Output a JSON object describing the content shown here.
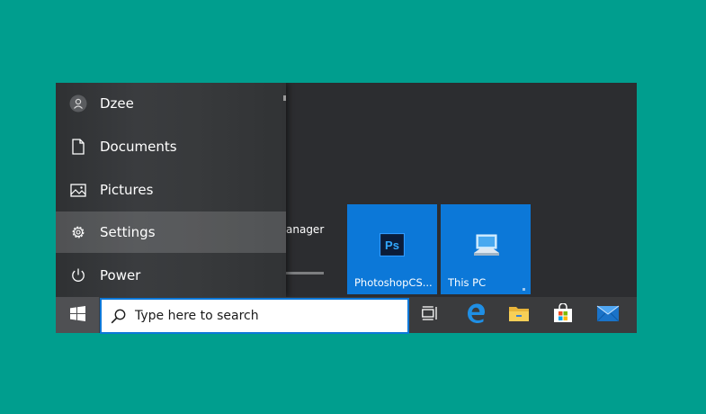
{
  "start_menu": {
    "user_label": "Dzee",
    "items": [
      {
        "label": "Documents",
        "icon": "document-icon"
      },
      {
        "label": "Pictures",
        "icon": "pictures-icon"
      },
      {
        "label": "Settings",
        "icon": "gear-icon"
      },
      {
        "label": "Power",
        "icon": "power-icon"
      }
    ],
    "app_list_fragment": "anager",
    "tiles": [
      {
        "label": "PhotoshopCS...",
        "icon_text": "Ps"
      },
      {
        "label": "This PC"
      }
    ]
  },
  "taskbar": {
    "search_placeholder": "Type here to search",
    "icons": [
      "task-view-icon",
      "edge-icon",
      "file-explorer-icon",
      "store-icon",
      "mail-icon"
    ]
  },
  "colors": {
    "desktop": "#009e8e",
    "accent": "#0c78d8",
    "start_bg": "#2c2d30",
    "taskbar_bg": "#3a3b3d"
  }
}
